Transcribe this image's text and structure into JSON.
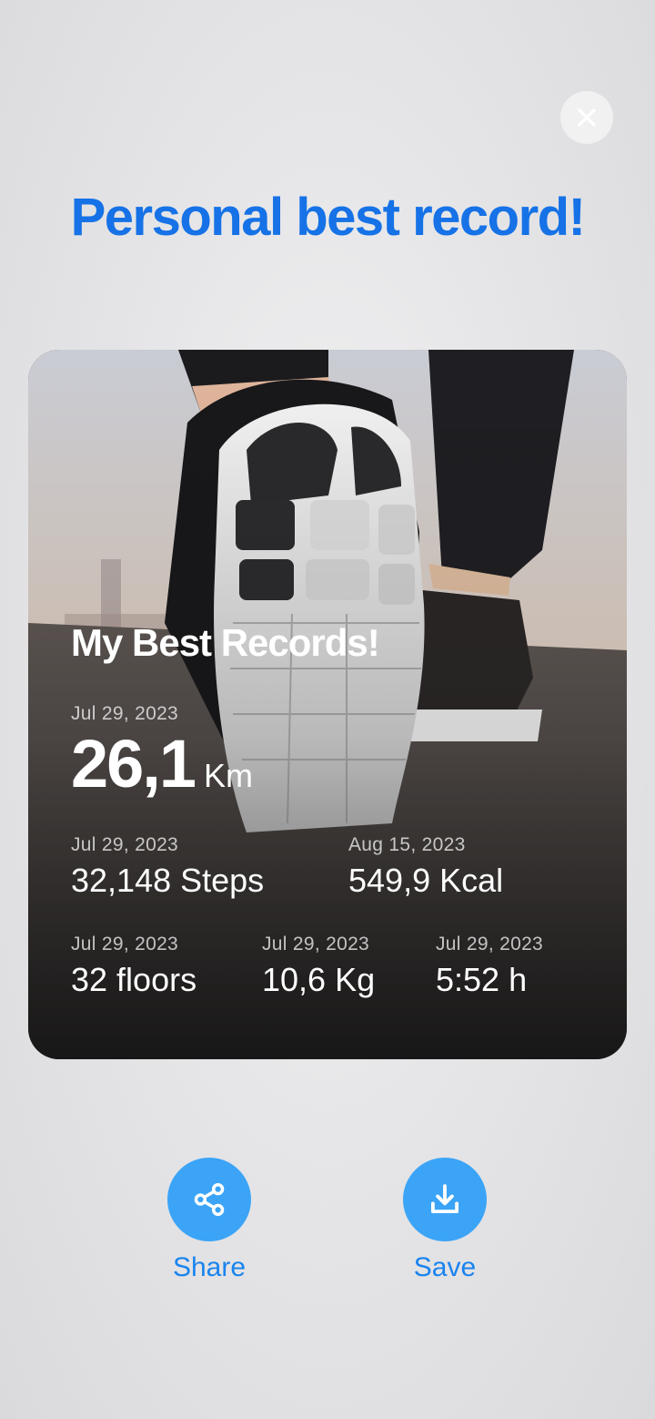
{
  "header": {
    "title": "Personal best record!",
    "close_icon": "close-icon"
  },
  "card": {
    "heading": "My Best Records!",
    "background": "photo of a running shoe sole on asphalt at sunset",
    "distance": {
      "date": "Jul 29, 2023",
      "value": "26,1",
      "unit": "Km"
    },
    "steps": {
      "date": "Jul 29, 2023",
      "value": "32,148 Steps"
    },
    "calories": {
      "date": "Aug 15, 2023",
      "value": "549,9 Kcal"
    },
    "floors": {
      "date": "Jul 29, 2023",
      "value": "32 floors"
    },
    "weight": {
      "date": "Jul 29, 2023",
      "value": "10,6 Kg"
    },
    "duration": {
      "date": "Jul 29, 2023",
      "value": "5:52 h"
    }
  },
  "actions": {
    "share": {
      "label": "Share",
      "icon": "share-icon"
    },
    "save": {
      "label": "Save",
      "icon": "download-icon"
    }
  },
  "colors": {
    "title": "#1672e6",
    "action_circle": "#3ba4f7",
    "action_label": "#1a84ee"
  }
}
